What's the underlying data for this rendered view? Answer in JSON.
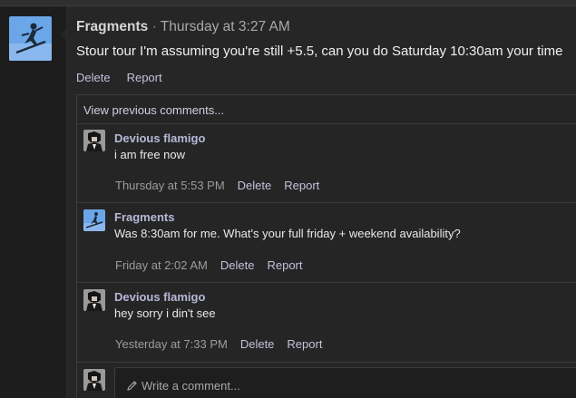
{
  "post": {
    "author": "Fragments",
    "separator": "·",
    "time": "Thursday at 3:27 AM",
    "body": "Stour tour I'm assuming you're still +5.5, can you do Saturday 10:30am your time",
    "delete_label": "Delete",
    "report_label": "Report"
  },
  "thread": {
    "view_previous": "View previous comments...",
    "comments": [
      {
        "author": "Devious flamigo",
        "text": "i am free now",
        "time": "Thursday at 5:53 PM",
        "delete_label": "Delete",
        "report_label": "Report",
        "avatar": "dark-figure-avatar"
      },
      {
        "author": "Fragments",
        "text": "Was 8:30am for me. What's your full friday + weekend availability?",
        "time": "Friday at 2:02 AM",
        "delete_label": "Delete",
        "report_label": "Report",
        "avatar": "skier-avatar"
      },
      {
        "author": "Devious flamigo",
        "text": "hey sorry i din't see",
        "time": "Yesterday at 7:33 PM",
        "delete_label": "Delete",
        "report_label": "Report",
        "avatar": "dark-figure-avatar"
      }
    ],
    "reply_placeholder": "Write a comment...",
    "reply_value": ""
  },
  "icons": {
    "pencil": "pencil-icon"
  },
  "colors": {
    "accent": "#c2c2dc",
    "author": "#b8b8d8",
    "background": "#262626",
    "avatar_sky": "#6aa6e8"
  }
}
